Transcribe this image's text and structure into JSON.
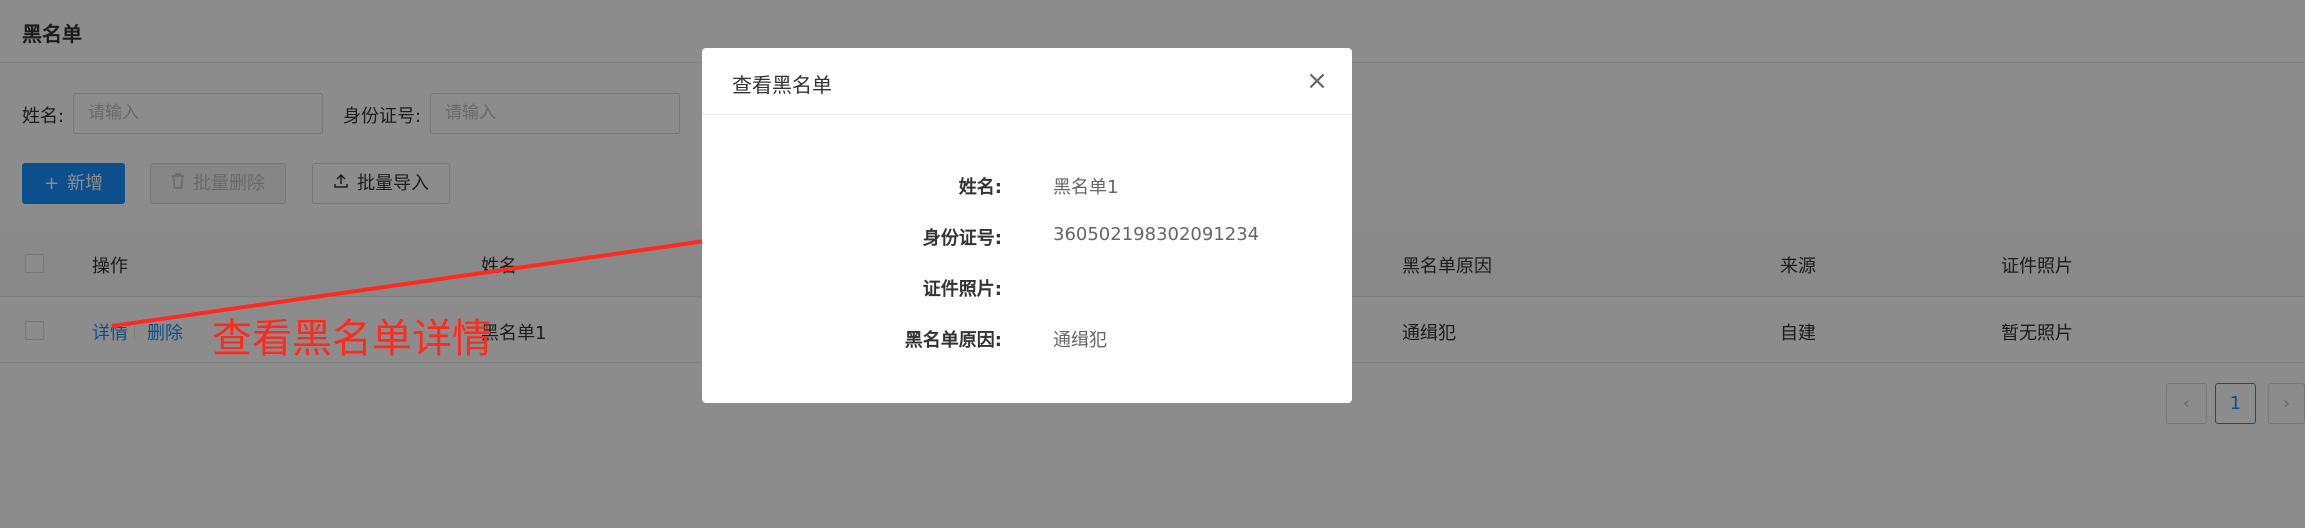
{
  "page": {
    "title": "黑名单"
  },
  "search": {
    "name_label": "姓名:",
    "name_placeholder": "请输入",
    "id_label": "身份证号:",
    "id_placeholder": "请输入"
  },
  "toolbar": {
    "add_label": "新增",
    "batch_delete_label": "批量删除",
    "batch_import_label": "批量导入"
  },
  "table": {
    "columns": [
      "操作",
      "姓名",
      "黑名单原因",
      "来源",
      "证件照片"
    ],
    "rows": [
      {
        "actions": [
          "详情",
          "删除"
        ],
        "name": "黑名单1",
        "reason": "通缉犯",
        "source": "自建",
        "photo": "暂无照片"
      }
    ]
  },
  "pagination": {
    "current": "1",
    "prev": "‹",
    "next": "›"
  },
  "annotation": {
    "text": "查看黑名单详情",
    "color": "#ff2a1f"
  },
  "modal": {
    "title": "查看黑名单",
    "close": "×",
    "fields": [
      {
        "label": "姓名:",
        "value": "黑名单1"
      },
      {
        "label": "身份证号:",
        "value": "360502198302091234"
      },
      {
        "label": "证件照片:",
        "value": ""
      },
      {
        "label": "黑名单原因:",
        "value": "通缉犯"
      }
    ]
  },
  "colors": {
    "primary": "#1890ff",
    "mask": "rgba(0,0,0,0.45)"
  }
}
